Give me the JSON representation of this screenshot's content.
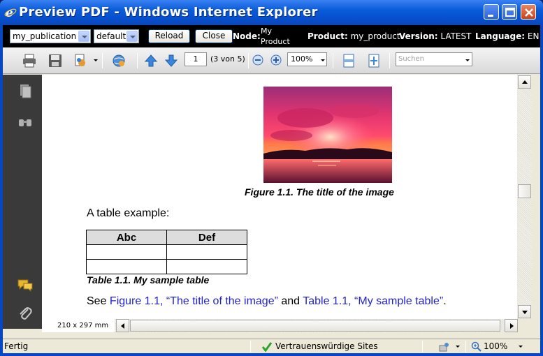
{
  "window": {
    "title": "Preview PDF - Windows Internet Explorer"
  },
  "header": {
    "publication_select": "my_publication",
    "profile_select": "default",
    "reload_label": "Reload",
    "close_label": "Close",
    "node_label": "Node:",
    "node_value_line1": "My",
    "node_value_line2": "Product",
    "product_label": "Product:",
    "product_value": "my_product",
    "version_label": "Version:",
    "version_value": "LATEST",
    "language_label": "Language:",
    "language_value": "EN"
  },
  "toolbar": {
    "current_page": "1",
    "page_count": "(3 von 5)",
    "zoom": "100%",
    "search_placeholder": "Suchen"
  },
  "document": {
    "figure_caption": "Figure 1.1. The title of the image",
    "paragraph": "A table example:",
    "table": {
      "headers": [
        "Abc",
        "Def"
      ]
    },
    "table_caption": "Table 1.1. My sample table",
    "xref": {
      "prefix": "See ",
      "link1": "Figure 1.1, “The title of the image”",
      "middle": " and ",
      "link2": "Table 1.1, “My sample table”",
      "suffix": "."
    },
    "page_size": "210 x 297 mm"
  },
  "statusbar": {
    "status": "Fertig",
    "zone": "Vertrauenswürdige Sites",
    "zoom": "100%"
  },
  "icons": {
    "ie_logo": "ie-logo-icon",
    "print": "print-icon",
    "save": "save-icon",
    "pages": "pages-icon",
    "search": "search-icon",
    "comments": "comments-icon",
    "attachments": "attachment-icon"
  }
}
